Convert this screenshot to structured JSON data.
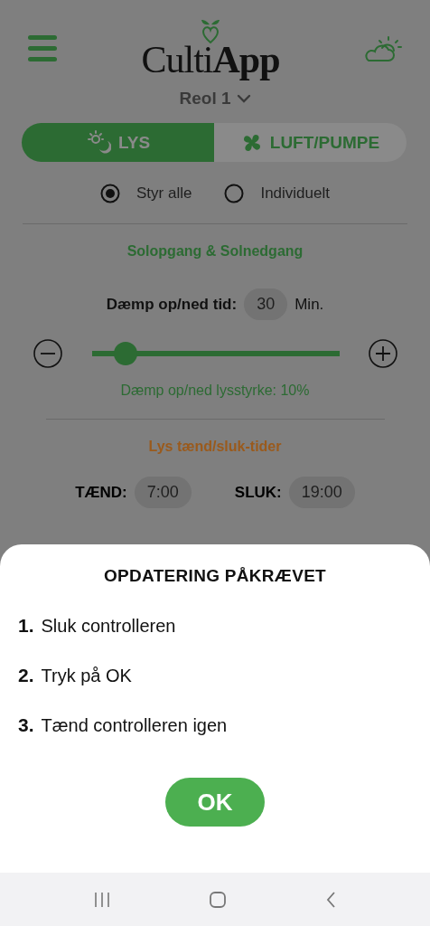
{
  "header": {
    "logo": "Culti**App**"
  },
  "shelf_selector": {
    "label": "Reol 1"
  },
  "tabs": [
    {
      "label": "LYS",
      "selected": true,
      "kind": "light"
    },
    {
      "label": "LUFT/PUMPE",
      "selected": false,
      "kind": "fan"
    }
  ],
  "control_mode": [
    {
      "label": "Styr alle",
      "selected": true
    },
    {
      "label": "Individuelt",
      "selected": false
    }
  ],
  "sunrise_section": {
    "heading": "Solopgang & Solnedgang",
    "dim_time_label": "Dæmp op/ned tid:",
    "dim_time_value": "30",
    "dim_time_unit": "Min.",
    "brightness_slider": {
      "level": 0.1
    },
    "brightness_reading": "Dæmp op/ned lysstyrke: 10%"
  },
  "schedule_section": {
    "heading": "Lys tænd/sluk-tider",
    "times": [
      {
        "label": "TÆND:",
        "value": "7:00"
      },
      {
        "label": "SLUK:",
        "value": "19:00"
      }
    ]
  },
  "dialog": {
    "title": "OPDATERING PÅKRÆVET",
    "steps": [
      {
        "number": "1.",
        "text": "Sluk controlleren"
      },
      {
        "number": "2.",
        "text": "Tryk på OK"
      },
      {
        "number": "3.",
        "text": "Tænd controlleren igen"
      }
    ],
    "button": "OK"
  }
}
